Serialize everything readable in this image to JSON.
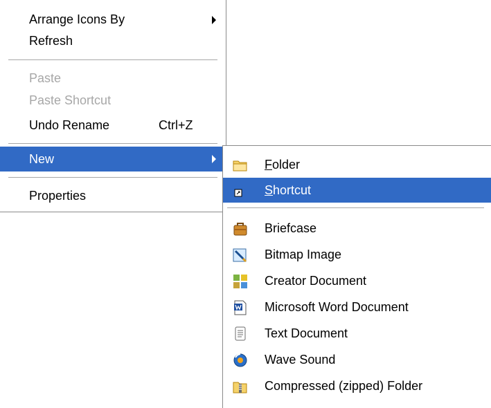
{
  "context_menu": {
    "items": [
      {
        "label": "Arrange Icons By",
        "has_submenu": true
      },
      {
        "label": "Refresh"
      },
      {
        "label": "Paste",
        "disabled": true
      },
      {
        "label": "Paste Shortcut",
        "disabled": true
      },
      {
        "label": "Undo Rename",
        "shortcut": "Ctrl+Z"
      },
      {
        "label": "New",
        "has_submenu": true,
        "highlighted": true
      },
      {
        "label": "Properties"
      }
    ]
  },
  "new_submenu": {
    "items": [
      {
        "label": "Folder",
        "mnemonic": "F",
        "icon": "folder-icon"
      },
      {
        "label": "Shortcut",
        "mnemonic": "S",
        "icon": "shortcut-icon",
        "highlighted": true
      },
      {
        "label": "Briefcase",
        "icon": "briefcase-icon"
      },
      {
        "label": "Bitmap Image",
        "icon": "bitmap-image-icon"
      },
      {
        "label": "Creator Document",
        "icon": "creator-document-icon"
      },
      {
        "label": "Microsoft Word Document",
        "icon": "word-document-icon"
      },
      {
        "label": "Text Document",
        "icon": "text-document-icon"
      },
      {
        "label": "Wave Sound",
        "icon": "wave-sound-icon"
      },
      {
        "label": "Compressed (zipped) Folder",
        "icon": "zipped-folder-icon"
      }
    ]
  },
  "colors": {
    "highlight": "#316ac5",
    "disabled_text": "#a7a7a7",
    "border": "#8a8a8a"
  }
}
